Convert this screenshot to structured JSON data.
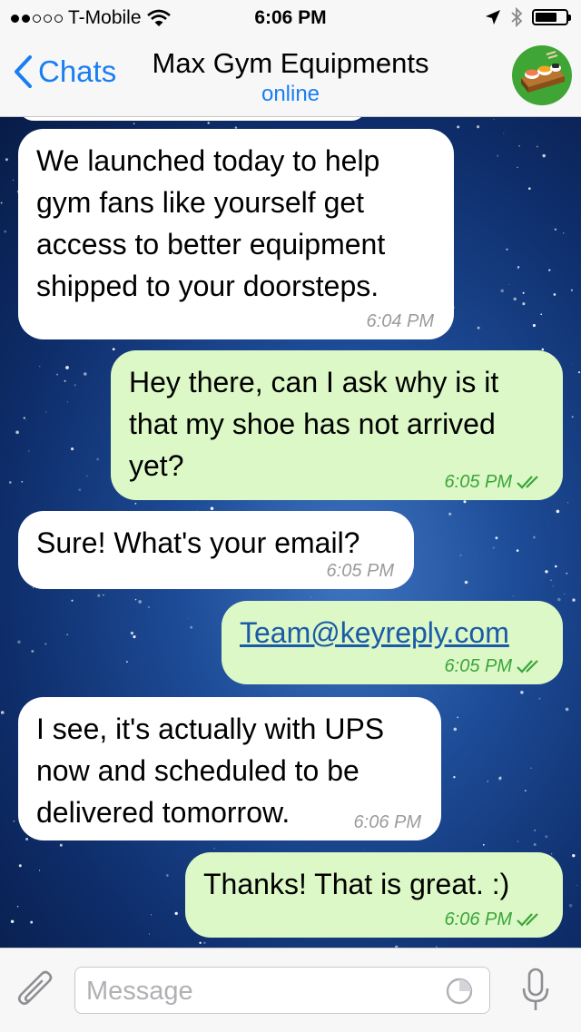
{
  "status_bar": {
    "carrier": "T-Mobile",
    "time": "6:06 PM"
  },
  "header": {
    "back_label": "Chats",
    "title": "Max Gym Equipments",
    "status": "online"
  },
  "messages": [
    {
      "direction": "in",
      "lines": [
        "We launched today to help",
        "gym fans like yourself get",
        "access to better equipment",
        "shipped to your doorsteps."
      ],
      "time": "6:04 PM"
    },
    {
      "direction": "out",
      "lines": [
        "Hey there, can I ask why is it",
        "that my shoe has not arrived",
        "yet?"
      ],
      "time": "6:05 PM",
      "read": true
    },
    {
      "direction": "in",
      "lines": [
        "Sure! What's your email?"
      ],
      "time": "6:05 PM"
    },
    {
      "direction": "out",
      "lines": [
        "Team@keyreply.com"
      ],
      "time": "6:05 PM",
      "read": true,
      "is_link": true
    },
    {
      "direction": "in",
      "lines": [
        "I see, it's actually with UPS",
        "now and scheduled to be",
        "delivered tomorrow."
      ],
      "time": "6:06 PM"
    },
    {
      "direction": "out",
      "lines": [
        "Thanks! That is great. :)"
      ],
      "time": "6:06 PM",
      "read": true
    }
  ],
  "composer": {
    "placeholder": "Message"
  },
  "colors": {
    "accent": "#1a7ef2",
    "outgoing_bubble": "#dcf8c6",
    "incoming_bubble": "#ffffff",
    "read_check": "#3aa53a"
  },
  "icons": [
    "signal-dots-icon",
    "wifi-icon",
    "location-arrow-icon",
    "bluetooth-icon",
    "battery-icon",
    "chevron-left-icon",
    "sushi-avatar-icon",
    "paperclip-icon",
    "sticker-icon",
    "microphone-icon",
    "double-check-icon"
  ]
}
